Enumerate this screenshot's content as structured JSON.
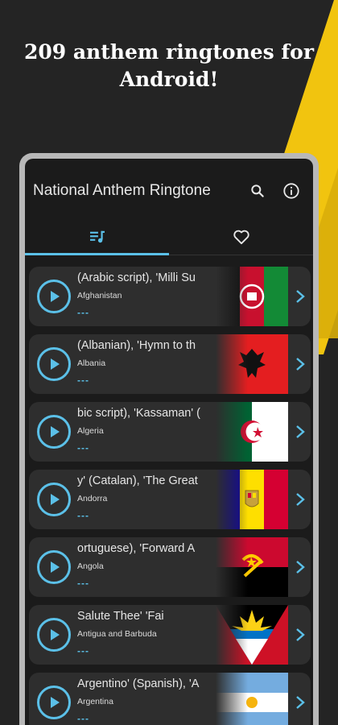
{
  "promo": {
    "line1": "209 anthem ringtones for",
    "line2": "Android!"
  },
  "app": {
    "title": "National Anthem Ringtone"
  },
  "colors": {
    "accent": "#5bc0e8",
    "brand_yellow": "#f1c40f"
  },
  "tabs": [
    {
      "icon": "music-list-icon",
      "selected": true
    },
    {
      "icon": "heart-icon",
      "selected": false
    }
  ],
  "items": [
    {
      "anthem": "(Arabic script), 'Milli Su",
      "country": "Afghanistan",
      "more": "---"
    },
    {
      "anthem": "(Albanian), 'Hymn to th",
      "country": "Albania",
      "more": "---"
    },
    {
      "anthem": "bic script), 'Kassaman' (",
      "country": "Algeria",
      "more": "---"
    },
    {
      "anthem": "y' (Catalan), 'The Great",
      "country": "Andorra",
      "more": "---"
    },
    {
      "anthem": "ortuguese), 'Forward A",
      "country": "Angola",
      "more": "---"
    },
    {
      "anthem": "Salute Thee'          'Fai",
      "country": "Antigua and Barbuda",
      "more": "---"
    },
    {
      "anthem": "Argentino' (Spanish), 'A",
      "country": "Argentina",
      "more": "---"
    }
  ]
}
